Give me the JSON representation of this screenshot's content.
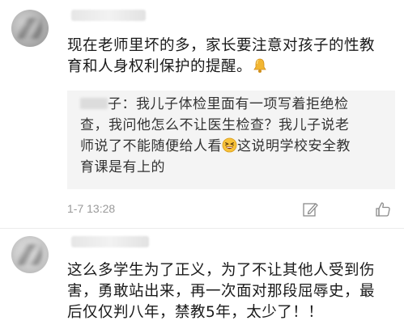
{
  "comment1": {
    "text_line1": "现在老师里坏的多，家长要注意对孩子的性教",
    "text_line2": "育和人身权利保护的提醒。",
    "quote": {
      "line1_after_name": "子：我儿子体检里面有一项写着拒绝检",
      "line2": "查，我问他怎么不让医生检查？我儿子说老",
      "line3_before_emoji": "师说了不能随便给人看",
      "line3_after_emoji": "这说明学校安全教",
      "line4": "育课是有上的"
    },
    "timestamp": "1-7 13:28"
  },
  "comment2": {
    "text_line1": "这么多学生为了正义，为了不让其他人受到伤",
    "text_line2": "害，勇敢站出来，再一次面对那段屈辱史，最",
    "text_line3": "后仅仅判八年，禁教5年，太少了！！"
  },
  "icons": {
    "bell": "bell-icon",
    "laugh": "grinning-squint-emoji-icon",
    "edit": "edit-icon",
    "like": "thumbs-up-icon"
  },
  "colors": {
    "timestamp": "#9a9a9a",
    "quote_bg": "#f4f4f4"
  }
}
